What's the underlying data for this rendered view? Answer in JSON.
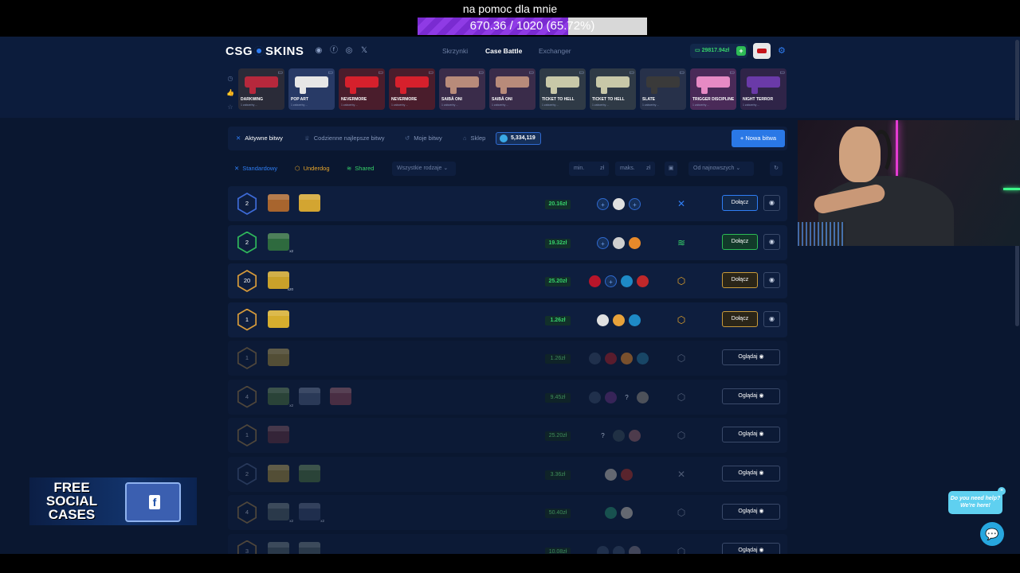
{
  "stream": {
    "goal_title": "na pomoc dla mnie",
    "goal_text": "670.36 / 1020 (65.72%)",
    "goal_progress": 0.6572
  },
  "header": {
    "logo_left": "CSG",
    "logo_right": "SKINS",
    "nav": [
      "Skrzynki",
      "Case Battle",
      "Exchanger"
    ],
    "nav_active": "Case Battle",
    "balance": "29817.94zł",
    "balance_plus": "+",
    "social_icons": [
      "discord-icon",
      "facebook-icon",
      "instagram-icon",
      "x-icon"
    ]
  },
  "live_drops": [
    {
      "name": "DARKWING",
      "sub": "1 zaboerby ...",
      "bg": "#2a2b38",
      "gun": "#b6283c"
    },
    {
      "name": "POP ART",
      "sub": "1 zaboerby ...",
      "bg": "#283a66",
      "gun": "#e6e6e6"
    },
    {
      "name": "NEVERMORE",
      "sub": "1 zaboerby ...",
      "bg": "#4a1d2c",
      "gun": "#d6202c"
    },
    {
      "name": "NEVERMORE",
      "sub": "1 zaboerby ...",
      "bg": "#4a1d2c",
      "gun": "#d6202c"
    },
    {
      "name": "SAIBĀ ONI",
      "sub": "1 zaboerby ...",
      "bg": "#3a2c4a",
      "gun": "#b88b7a"
    },
    {
      "name": "SAIBĀ ONI",
      "sub": "1 zaboerby ...",
      "bg": "#3a2c4a",
      "gun": "#b88b7a"
    },
    {
      "name": "TICKET TO HELL",
      "sub": "1 zaboerby ...",
      "bg": "#2f3a46",
      "gun": "#c8c8a8"
    },
    {
      "name": "TICKET TO HELL",
      "sub": "1 zaboerby ...",
      "bg": "#2f3a46",
      "gun": "#c8c8a8"
    },
    {
      "name": "SLATE",
      "sub": "1 zaboerby ...",
      "bg": "#27314a",
      "gun": "#3a3a3a"
    },
    {
      "name": "TRIGGER DISCIPLINE",
      "sub": "1 zaboerby ...",
      "bg": "#4a2a58",
      "gun": "#e68ac4"
    },
    {
      "name": "NIGHT TERROR",
      "sub": "1 zaboerby ...",
      "bg": "#2f2448",
      "gun": "#6a3aa8"
    }
  ],
  "tabs": [
    {
      "label": "Aktywne bitwy",
      "icon": "swords-icon",
      "glyph": "✕"
    },
    {
      "label": "Codzienne najlepsze bitwy",
      "icon": "trophy-icon",
      "glyph": "♕"
    },
    {
      "label": "Moje bitwy",
      "icon": "history-icon",
      "glyph": "↺"
    },
    {
      "label": "Sklep",
      "icon": "shop-icon",
      "glyph": "⌂"
    }
  ],
  "gems": "5,334,119",
  "new_battle": "+ Nowa bitwa",
  "filters": {
    "modes": [
      {
        "label": "Standardowy",
        "color": "#2f7ef5",
        "glyph": "✕"
      },
      {
        "label": "Underdog",
        "color": "#e6a52a",
        "glyph": "⬡"
      },
      {
        "label": "Shared",
        "color": "#36d26a",
        "glyph": "≋"
      }
    ],
    "type_select": "Wszystkie rodzaje",
    "min_placeholder": "min.",
    "min_unit": "zł",
    "max_placeholder": "maks.",
    "max_unit": "zł",
    "sort_select": "Od najnowszych"
  },
  "battles": [
    {
      "rounds": "2",
      "ring": "#3d6ad6",
      "price": "20.16zł",
      "mode": "standard",
      "action": "join",
      "dim": false,
      "cases": [
        {
          "color": "#a8652e",
          "qty": ""
        },
        {
          "color": "#d3a531",
          "qty": ""
        }
      ],
      "players": [
        {
          "kind": "empty"
        },
        {
          "kind": "avatar",
          "color": "#e0e0e0"
        },
        {
          "kind": "empty"
        }
      ]
    },
    {
      "rounds": "2",
      "ring": "#2fb65b",
      "price": "19.32zł",
      "mode": "shared",
      "action": "join",
      "dim": false,
      "cases": [
        {
          "color": "#2e6a3e",
          "qty": "x2"
        }
      ],
      "players": [
        {
          "kind": "empty"
        },
        {
          "kind": "avatar",
          "color": "#cfcfcf"
        },
        {
          "kind": "avatar",
          "color": "#e88a2a"
        }
      ]
    },
    {
      "rounds": "20",
      "ring": "#d69a3a",
      "price": "25.20zł",
      "mode": "underdog",
      "action": "join",
      "dim": false,
      "cases": [
        {
          "color": "#c9a12a",
          "qty": "x20"
        }
      ],
      "players": [
        {
          "kind": "avatar",
          "color": "#b8152a"
        },
        {
          "kind": "empty"
        },
        {
          "kind": "avatar",
          "color": "#1e8ac6"
        },
        {
          "kind": "avatar",
          "color": "#c0282a"
        }
      ]
    },
    {
      "rounds": "1",
      "ring": "#d69a3a",
      "price": "1.26zł",
      "mode": "underdog",
      "action": "join",
      "dim": false,
      "cases": [
        {
          "color": "#d6ae2e",
          "qty": ""
        }
      ],
      "players": [
        {
          "kind": "avatar",
          "color": "#e0e0e0"
        },
        {
          "kind": "avatar",
          "color": "#e8a23a"
        },
        {
          "kind": "avatar",
          "color": "#1e8ac6"
        }
      ]
    },
    {
      "rounds": "1",
      "ring": "#6b5a3e",
      "price": "1.26zł",
      "mode": "underdog",
      "action": "watch",
      "dim": true,
      "cases": [
        {
          "color": "#7a6a36",
          "qty": ""
        }
      ],
      "players": [
        {
          "kind": "avatar",
          "color": "#2a3a56"
        },
        {
          "kind": "avatar",
          "color": "#7a1e2a"
        },
        {
          "kind": "avatar",
          "color": "#a8682a"
        },
        {
          "kind": "avatar",
          "color": "#1e5a7a"
        }
      ]
    },
    {
      "rounds": "4",
      "ring": "#6b5a3e",
      "price": "9.45zł",
      "mode": "underdog",
      "action": "watch",
      "dim": true,
      "cases": [
        {
          "color": "#3a5a3a",
          "qty": "x2"
        },
        {
          "color": "#3a4a6a",
          "qty": ""
        },
        {
          "color": "#6a3a4a",
          "qty": ""
        }
      ],
      "players": [
        {
          "kind": "avatar",
          "color": "#2a3a56"
        },
        {
          "kind": "avatar",
          "color": "#4a2a66"
        },
        {
          "kind": "unknown"
        },
        {
          "kind": "avatar",
          "color": "#6a6a6a"
        }
      ]
    },
    {
      "rounds": "1",
      "ring": "#6b5a3e",
      "price": "25.20zł",
      "mode": "underdog",
      "action": "watch",
      "dim": true,
      "cases": [
        {
          "color": "#4a2a3a",
          "qty": ""
        }
      ],
      "players": [
        {
          "kind": "unknown"
        },
        {
          "kind": "avatar",
          "color": "#2a3a4a"
        },
        {
          "kind": "avatar",
          "color": "#6a4a56"
        }
      ]
    },
    {
      "rounds": "2",
      "ring": "#34466a",
      "price": "3.36zł",
      "mode": "standard",
      "action": "watch",
      "dim": true,
      "cases": [
        {
          "color": "#7a6a36",
          "qty": ""
        },
        {
          "color": "#3a5a3a",
          "qty": ""
        }
      ],
      "players": [
        {
          "kind": "avatar",
          "color": "#8a8a8a"
        },
        {
          "kind": "avatar",
          "color": "#7a2a2a"
        }
      ]
    },
    {
      "rounds": "4",
      "ring": "#6b5a3e",
      "price": "50.40zł",
      "mode": "underdog",
      "action": "watch",
      "dim": true,
      "cases": [
        {
          "color": "#3a4a56",
          "qty": "x2"
        },
        {
          "color": "#2a3a5a",
          "qty": "x2"
        }
      ],
      "players": [
        {
          "kind": "avatar",
          "color": "#1e6a5a"
        },
        {
          "kind": "avatar",
          "color": "#8a8a8a"
        }
      ]
    },
    {
      "rounds": "3",
      "ring": "#6b5a3e",
      "price": "10.08zł",
      "mode": "underdog",
      "action": "watch",
      "dim": true,
      "cases": [
        {
          "color": "#3a4a56",
          "qty": ""
        },
        {
          "color": "#3a4a56",
          "qty": ""
        }
      ],
      "players": [
        {
          "kind": "avatar",
          "color": "#2a3a56"
        },
        {
          "kind": "avatar",
          "color": "#2a3a56"
        },
        {
          "kind": "avatar",
          "color": "#5a5a6a"
        }
      ]
    }
  ],
  "labels": {
    "join": "Dołącz",
    "watch": "Oglądaj",
    "empty_slot": "+",
    "unknown_slot": "?"
  },
  "promo": {
    "line1": "FREE",
    "line2": "SOCIAL",
    "line3": "CASES",
    "badge": "f"
  },
  "help": {
    "text1": "Do you need help?",
    "text2": "We're here!",
    "close": "×"
  },
  "colors": {
    "accent": "#2f7ef5",
    "green": "#36d26a",
    "gold": "#e6a52a",
    "bg": "#0a1730"
  }
}
